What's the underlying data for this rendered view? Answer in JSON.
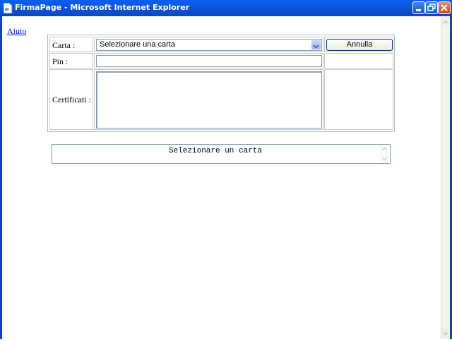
{
  "window": {
    "title": "FirmaPage - Microsoft Internet Explorer",
    "title_bar_color": "#0a5ff2",
    "icon": "ie-page-icon",
    "controls": [
      "minimize-icon",
      "restore-icon",
      "close-icon"
    ]
  },
  "page": {
    "help_link": "Aiuto",
    "form": {
      "card_label": "Carta :",
      "card_select_value": "Selezionare una carta",
      "cancel_button": "Annulla",
      "pin_label": "Pin :",
      "pin_value": "",
      "certificates_label": "Certificati :",
      "certificates_value": ""
    },
    "status_message": "Selezionare un carta"
  }
}
